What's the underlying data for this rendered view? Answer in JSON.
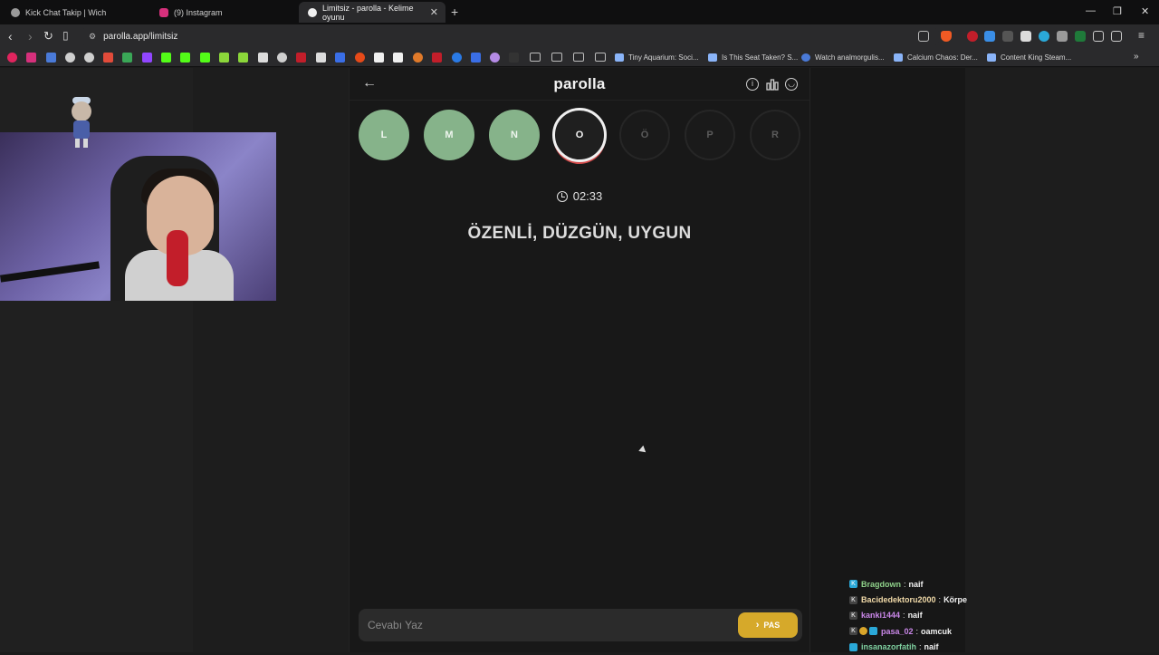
{
  "browser": {
    "tabs": [
      {
        "label": "Kick Chat Takip | Wich",
        "active": false
      },
      {
        "label": "(9) Instagram",
        "active": false
      },
      {
        "label": "Limitsiz - parolla - Kelime oyunu",
        "active": true
      }
    ],
    "url": "parolla.app/limitsiz",
    "bookmarks": [
      "Tiny Aquarium: Soci...",
      "Is This Seat Taken? S...",
      "Watch analmorgulis...",
      "Calcium Chaos: Der...",
      "Content King Steam..."
    ],
    "colors": {
      "tabstrip": "#0f0f10",
      "toolbar": "#2a2a2c"
    }
  },
  "app": {
    "brand": "parolla",
    "timer": "02:33",
    "clue": "ÖZENLİ, DÜZGÜN, UYGUN",
    "letters": [
      {
        "char": "L",
        "state": "done"
      },
      {
        "char": "M",
        "state": "done"
      },
      {
        "char": "N",
        "state": "done"
      },
      {
        "char": "O",
        "state": "current"
      },
      {
        "char": "Ö",
        "state": "pending"
      },
      {
        "char": "P",
        "state": "pending"
      },
      {
        "char": "R",
        "state": "pending"
      }
    ],
    "answer_placeholder": "Cevabı Yaz",
    "pass_label": "PAS",
    "colors": {
      "done": "#86b38a",
      "pass": "#d6a92a",
      "current_ring": "#d24a4a"
    }
  },
  "chat": [
    {
      "user": "Bragdown",
      "sep": ":",
      "msg": "naif",
      "color": "#8fd18a"
    },
    {
      "user": "Bacidedektoru2000",
      "sep": ":",
      "msg": "Körpe",
      "color": "#f0d9a8"
    },
    {
      "user": "kanki1444",
      "sep": ":",
      "msg": "naif",
      "color": "#c987e8"
    },
    {
      "user": "pasa_02",
      "sep": ":",
      "msg": "oamcuk",
      "color": "#c987e8"
    },
    {
      "user": "insanazorfatih",
      "sep": ":",
      "msg": "naif",
      "color": "#7fd0a0"
    }
  ]
}
